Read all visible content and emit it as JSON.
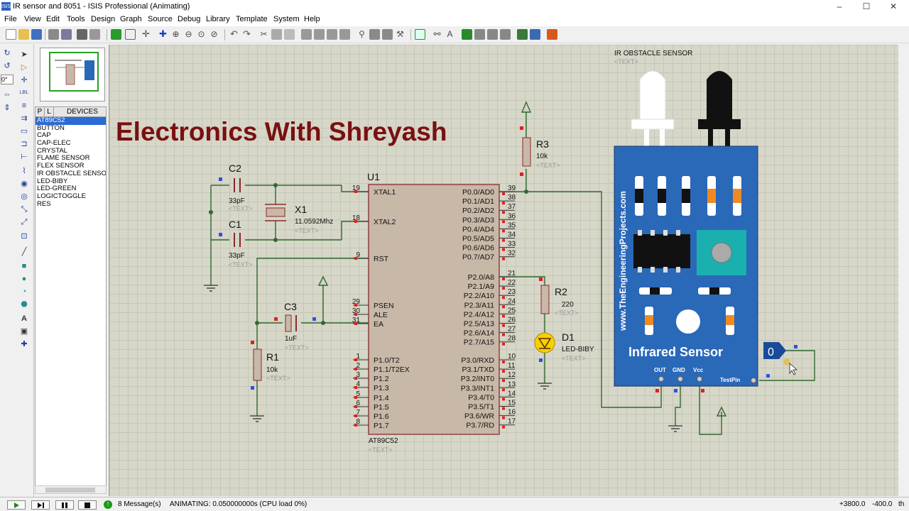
{
  "window": {
    "title": "IR sensor and 8051 - ISIS Professional (Animating)",
    "icon_text": "ISIS",
    "minimize": "–",
    "maximize": "☐",
    "close": "✕"
  },
  "menu": [
    "File",
    "View",
    "Edit",
    "Tools",
    "Design",
    "Graph",
    "Source",
    "Debug",
    "Library",
    "Template",
    "System",
    "Help"
  ],
  "left_tools": {
    "rotation_value": "0°"
  },
  "device_panel": {
    "tab_p": "P",
    "tab_l": "L",
    "header": "DEVICES",
    "items": [
      "AT89C52",
      "BUTTON",
      "CAP",
      "CAP-ELEC",
      "CRYSTAL",
      "FLAME SENSOR",
      "FLEX SENSOR",
      "IR OBSTACLE SENSOR",
      "LED-BIBY",
      "LED-GREEN",
      "LOGICTOGGLE",
      "RES"
    ],
    "selected": "AT89C52"
  },
  "schematic": {
    "heading": "Electronics With Shreyash",
    "text_placeholder": "<TEXT>",
    "u1": {
      "ref": "U1",
      "part": "AT89C52",
      "left_pins": [
        [
          "19",
          "XTAL1"
        ],
        [
          "18",
          "XTAL2"
        ],
        [
          "9",
          "RST"
        ],
        [
          "29",
          "PSEN"
        ],
        [
          "30",
          "ALE"
        ],
        [
          "31",
          "EA"
        ],
        [
          "1",
          "P1.0/T2"
        ],
        [
          "2",
          "P1.1/T2EX"
        ],
        [
          "3",
          "P1.2"
        ],
        [
          "4",
          "P1.3"
        ],
        [
          "5",
          "P1.4"
        ],
        [
          "6",
          "P1.5"
        ],
        [
          "7",
          "P1.6"
        ],
        [
          "8",
          "P1.7"
        ]
      ],
      "right_pins": [
        [
          "39",
          "P0.0/AD0"
        ],
        [
          "38",
          "P0.1/AD1"
        ],
        [
          "37",
          "P0.2/AD2"
        ],
        [
          "36",
          "P0.3/AD3"
        ],
        [
          "35",
          "P0.4/AD4"
        ],
        [
          "34",
          "P0.5/AD5"
        ],
        [
          "33",
          "P0.6/AD6"
        ],
        [
          "32",
          "P0.7/AD7"
        ],
        [
          "21",
          "P2.0/A8"
        ],
        [
          "22",
          "P2.1/A9"
        ],
        [
          "23",
          "P2.2/A10"
        ],
        [
          "24",
          "P2.3/A11"
        ],
        [
          "25",
          "P2.4/A12"
        ],
        [
          "26",
          "P2.5/A13"
        ],
        [
          "27",
          "P2.6/A14"
        ],
        [
          "28",
          "P2.7/A15"
        ],
        [
          "10",
          "P3.0/RXD"
        ],
        [
          "11",
          "P3.1/TXD"
        ],
        [
          "12",
          "P3.2/INT0"
        ],
        [
          "13",
          "P3.3/INT1"
        ],
        [
          "14",
          "P3.4/T0"
        ],
        [
          "15",
          "P3.5/T1"
        ],
        [
          "16",
          "P3.6/WR"
        ],
        [
          "17",
          "P3.7/RD"
        ]
      ]
    },
    "c2": {
      "ref": "C2",
      "value": "33pF"
    },
    "c1": {
      "ref": "C1",
      "value": "33pF"
    },
    "x1": {
      "ref": "X1",
      "value": "11.0592Mhz"
    },
    "c3": {
      "ref": "C3",
      "value": "1uF"
    },
    "r1": {
      "ref": "R1",
      "value": "10k"
    },
    "r3": {
      "ref": "R3",
      "value": "10k"
    },
    "r2": {
      "ref": "R2",
      "value": "220"
    },
    "d1": {
      "ref": "D1",
      "value": "LED-BIBY"
    },
    "ir": {
      "ref": "IR OBSTACLE SENSOR",
      "site": "www.TheEngineeringProjects.com",
      "label": "Infrared Sensor",
      "pins": [
        "OUT",
        "GND",
        "Vcc"
      ],
      "testpin": "TestPin"
    },
    "logic_toggle": "0"
  },
  "status": {
    "messages": "8 Message(s)",
    "animating": "ANIMATING: 0.050000000s (CPU load 0%)",
    "coord_x": "+3800.0",
    "coord_y": "-400.0",
    "units": "th"
  },
  "colors": {
    "wire": "#2f6a2f",
    "component_fill": "#c8b8a8",
    "component_stroke": "#8b2a2a",
    "heading": "#7a1010",
    "sensor_board": "#2a68b8"
  }
}
